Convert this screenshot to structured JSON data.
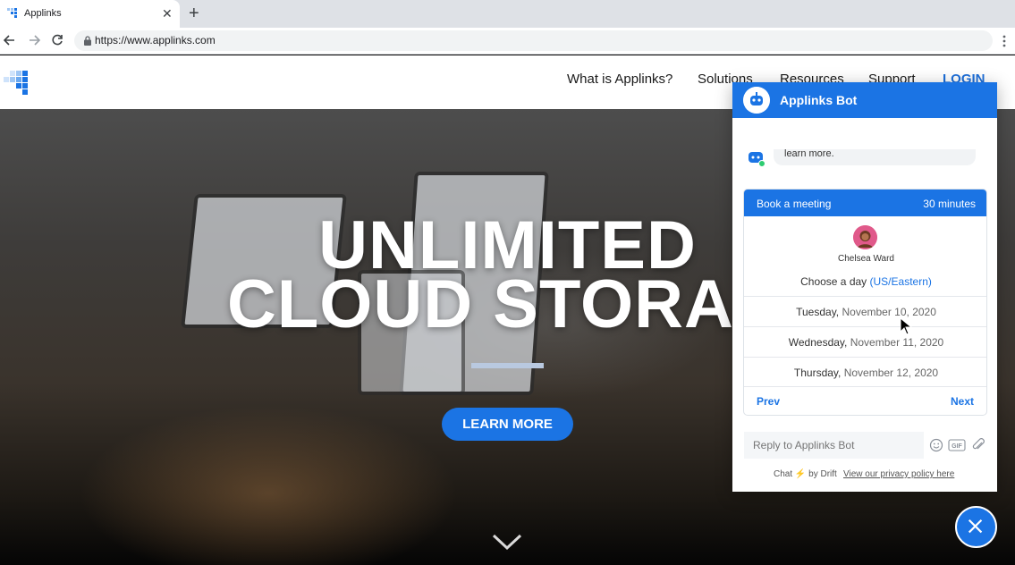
{
  "browser": {
    "tab_title": "Applinks",
    "url": "https://www.applinks.com"
  },
  "site": {
    "nav": [
      "What is Applinks?",
      "Solutions",
      "Resources",
      "Support"
    ],
    "login_label": "LOGIN"
  },
  "hero": {
    "title_line1": "UNLIMITED",
    "title_line2": "CLOUD STORAG",
    "cta_label": "LEARN MORE"
  },
  "chat": {
    "title": "Applinks Bot",
    "previous_message": "learn more.",
    "meeting": {
      "title": "Book a meeting",
      "duration": "30 minutes",
      "host_name": "Chelsea Ward",
      "choose_day_label": "Choose a day",
      "timezone": "(US/Eastern)",
      "days": [
        {
          "weekday": "Tuesday,",
          "date": "November 10, 2020"
        },
        {
          "weekday": "Wednesday,",
          "date": "November 11, 2020"
        },
        {
          "weekday": "Thursday,",
          "date": "November 12, 2020"
        }
      ],
      "prev_label": "Prev",
      "next_label": "Next"
    },
    "reply_placeholder": "Reply to Applinks Bot",
    "gif_label": "GIF",
    "footer_brand_prefix": "Chat",
    "footer_brand_suffix": "by Drift",
    "privacy_link": "View our privacy policy here"
  },
  "colors": {
    "accent": "#1b74e4",
    "login": "#1e6fd9"
  }
}
